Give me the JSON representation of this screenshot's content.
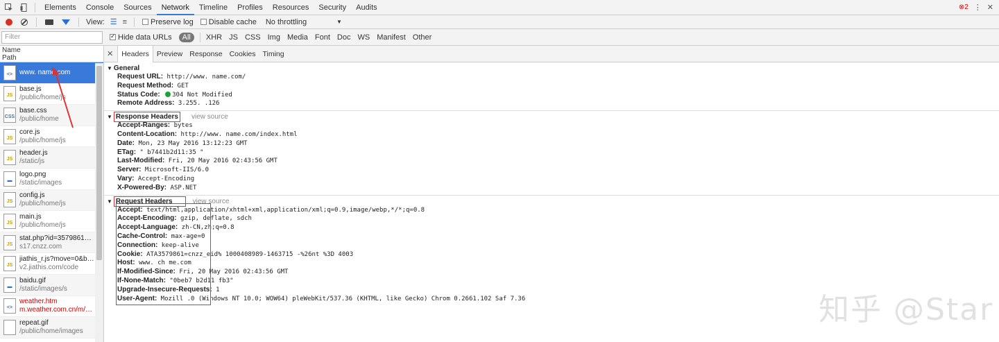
{
  "top_tabs": [
    "Elements",
    "Console",
    "Sources",
    "Network",
    "Timeline",
    "Profiles",
    "Resources",
    "Security",
    "Audits"
  ],
  "active_tab": "Network",
  "error_count": "2",
  "toolbar": {
    "view_label": "View:",
    "preserve_log": "Preserve log",
    "disable_cache": "Disable cache",
    "throttling": "No throttling"
  },
  "filter": {
    "placeholder": "Filter",
    "hide_data_urls": "Hide data URLs",
    "types": [
      "All",
      "XHR",
      "JS",
      "CSS",
      "Img",
      "Media",
      "Font",
      "Doc",
      "WS",
      "Manifest",
      "Other"
    ]
  },
  "list_header": {
    "name": "Name",
    "path": "Path"
  },
  "requests": [
    {
      "name": "www.        name.com",
      "path": "",
      "icon": "html",
      "icon_label": "<>"
    },
    {
      "name": "base.js",
      "path": "/public/home/js",
      "icon": "js",
      "icon_label": "JS"
    },
    {
      "name": "base.css",
      "path": "/public/home",
      "icon": "css",
      "icon_label": "CSS"
    },
    {
      "name": "core.js",
      "path": "/public/home/js",
      "icon": "js",
      "icon_label": "JS"
    },
    {
      "name": "header.js",
      "path": "/static/js",
      "icon": "js",
      "icon_label": "JS"
    },
    {
      "name": "logo.png",
      "path": "/static/images",
      "icon": "img",
      "icon_label": "▬"
    },
    {
      "name": "config.js",
      "path": "/public/home/js",
      "icon": "js",
      "icon_label": "JS"
    },
    {
      "name": "main.js",
      "path": "/public/home/js",
      "icon": "js",
      "icon_label": "JS"
    },
    {
      "name": "stat.php?id=3579861&we...",
      "path": "s17.cnzz.com",
      "icon": "js",
      "icon_label": "JS"
    },
    {
      "name": "jiathis_r.js?move=0&btn=...",
      "path": "v2.jiathis.com/code",
      "icon": "js",
      "icon_label": "JS"
    },
    {
      "name": "baidu.gif",
      "path": "/static/images/s",
      "icon": "img",
      "icon_label": "▬"
    },
    {
      "name": "weather.htm",
      "path": "m.weather.com.cn/m/pn8",
      "icon": "html",
      "icon_label": "<>"
    },
    {
      "name": "repeat.gif",
      "path": "/public/home/images",
      "icon": "img",
      "icon_label": ""
    }
  ],
  "detail_tabs": [
    "Headers",
    "Preview",
    "Response",
    "Cookies",
    "Timing"
  ],
  "general": {
    "title": "General",
    "rows": [
      {
        "k": "Request URL:",
        "v": "http://www.        name.com/"
      },
      {
        "k": "Request Method:",
        "v": "GET"
      },
      {
        "k": "Status Code:",
        "v": "304 Not Modified"
      },
      {
        "k": "Remote Address:",
        "v": "  3.255.    .126"
      }
    ]
  },
  "response_headers": {
    "title": "Response Headers",
    "view_source": "view source",
    "rows": [
      {
        "k": "Accept-Ranges:",
        "v": "bytes"
      },
      {
        "k": "Content-Location:",
        "v": "http://www.      name.com/index.html"
      },
      {
        "k": "Date:",
        "v": "Mon, 23 May 2016 13:12:23 GMT"
      },
      {
        "k": "ETag:",
        "v": "\"   b7441b2d11:35   \""
      },
      {
        "k": "Last-Modified:",
        "v": "Fri, 20 May 2016 02:43:56 GMT"
      },
      {
        "k": "Server:",
        "v": "Microsoft-IIS/6.0"
      },
      {
        "k": "Vary:",
        "v": "Accept-Encoding"
      },
      {
        "k": "X-Powered-By:",
        "v": "ASP.NET"
      }
    ]
  },
  "request_headers": {
    "title": "Request Headers",
    "view_source": "view source",
    "rows": [
      {
        "k": "Accept:",
        "v": "text/html,application/xhtml+xml,application/xml;q=0.9,image/webp,*/*;q=0.8"
      },
      {
        "k": "Accept-Encoding:",
        "v": "gzip, deflate, sdch"
      },
      {
        "k": "Accept-Language:",
        "v": "zh-CN,zh;q=0.8"
      },
      {
        "k": "Cache-Control:",
        "v": "max-age=0"
      },
      {
        "k": "Connection:",
        "v": "keep-alive"
      },
      {
        "k": "Cookie:",
        "v": "    ATA3579861=cnzz_eid%   1000408989-1463715   -%26nt   %3D   4003"
      },
      {
        "k": "Host:",
        "v": "www.    ch   me.com"
      },
      {
        "k": "If-Modified-Since:",
        "v": "Fri, 20 May 2016 02:43:56 GMT"
      },
      {
        "k": "If-None-Match:",
        "v": "\"0beb7    b2d11   fb3\""
      },
      {
        "k": "Upgrade-Insecure-Requests:",
        "v": "1"
      },
      {
        "k": "User-Agent:",
        "v": "Mozill    .0 (Windows NT 10.0; WOW64)     pleWebKit/537.36 (KHTML, like Gecko) Chrom     0.2661.102 Saf     7.36"
      }
    ]
  },
  "watermark": "知乎 @Star",
  "colors": {
    "accent": "#3879d9",
    "annotation": "#d33333",
    "status_ok": "#1aa336"
  }
}
